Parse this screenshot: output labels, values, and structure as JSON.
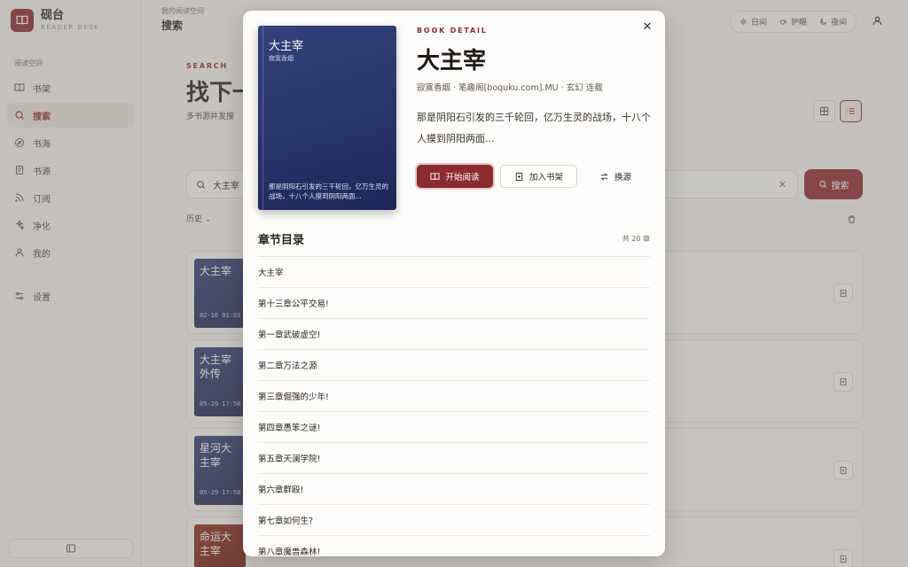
{
  "brand": {
    "name": "砚台",
    "sub": "READER DESK"
  },
  "sidebar": {
    "section": "阅读空间",
    "items": [
      {
        "label": "书架",
        "icon": "book-open-icon"
      },
      {
        "label": "搜索",
        "icon": "search-icon",
        "active": true
      },
      {
        "label": "书海",
        "icon": "compass-icon"
      },
      {
        "label": "书源",
        "icon": "document-icon"
      },
      {
        "label": "订阅",
        "icon": "rss-icon"
      },
      {
        "label": "净化",
        "icon": "clean-icon"
      },
      {
        "label": "我的",
        "icon": "user-icon"
      }
    ],
    "settings": "设置"
  },
  "header": {
    "breadcrumb": "我的阅读空间",
    "title": "搜索",
    "themes": [
      {
        "label": "日间",
        "icon": "sun-icon"
      },
      {
        "label": "护眼",
        "icon": "cup-icon"
      },
      {
        "label": "夜间",
        "icon": "moon-icon"
      }
    ]
  },
  "search_page": {
    "kicker": "SEARCH",
    "title": "找下一",
    "desc": "多书源并发搜",
    "query": "大主宰",
    "button": "搜索",
    "history": "历史",
    "results": [
      {
        "title": "大主宰",
        "date": "02-16 01:03"
      },
      {
        "title": "大主宰外传",
        "date": "05-29 17:58"
      },
      {
        "title": "星河大主宰",
        "date": "05-29 17:58"
      },
      {
        "title": "命运大主宰",
        "date": ""
      }
    ],
    "result_source": "笔趣阁[boquku.com].MU"
  },
  "modal": {
    "kicker": "BOOK DETAIL",
    "title": "大主宰",
    "author": "寂寞香烟",
    "source": "笔趣阁[boquku.com].MU",
    "genre": "玄幻 连载",
    "meta_sep": " · ",
    "description": "那是阴阳石引发的三千轮回，亿万生灵的战场，十八个人摸到阴阳两面...",
    "cover_desc": "那是阴阳石引发的三千轮回，亿万生灵的战场，十八个人摸到阴阳两面...",
    "buttons": {
      "read": "开始阅读",
      "shelf": "加入书架",
      "change_source": "换源"
    },
    "toc_title": "章节目录",
    "toc_count": "共 20 章",
    "chapters": [
      "大主宰",
      "第十三章公平交易!",
      "第一章武破虚空!",
      "第二章万法之源",
      "第三章倔强的少年!",
      "第四章愚笨之谜!",
      "第五章天澜学院!",
      "第六章群殴!",
      "第七章如何生?",
      "第八章魔兽森林!"
    ]
  },
  "colors": {
    "accent": "#8c2b2e",
    "cover_blue": "#2b376f"
  }
}
